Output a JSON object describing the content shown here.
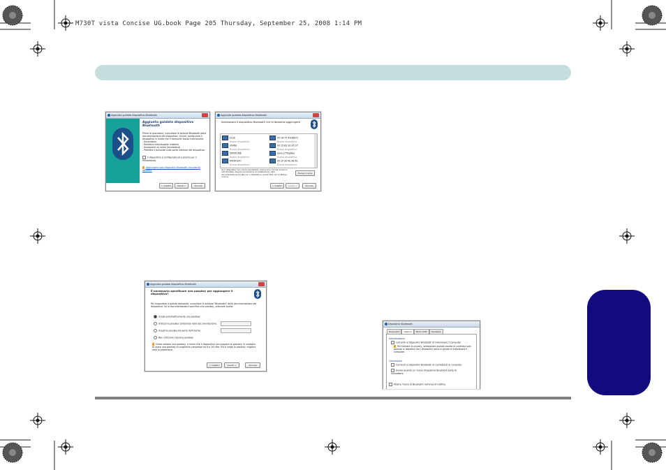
{
  "print_header": "M730T vista Concise UG.book  Page 205  Thursday, September 25, 2008  1:14 PM",
  "screenshots": {
    "wizard_intro": {
      "window_title": "Aggiunta guidata dispositivo Bluetooth",
      "heading": "Aggiunta guidata dispositivo",
      "heading2": "Bluetooth",
      "body": "Prima di procedere, consultare la sezione Bluetooth della documentazione del dispositivo. Quindi, configurare il dispositivo in modo che il computer possa individuarlo:",
      "bullets": [
        "- Accenderlo",
        "- Renderlo individuabile (visibile)",
        "- Assegnare un nome (facoltativo)",
        "- Premere il pulsante sulla parte inferiore del dispositivo"
      ],
      "checkbox": "Il dispositivo è configurato ed è pronto per il rilevamento",
      "link": "Aggiungere solo dispositivi Bluetooth considerati affidabili",
      "buttons": [
        "< Indietro",
        "Avanti >",
        "Annulla"
      ]
    },
    "wizard_select": {
      "window_title": "Aggiunta guidata dispositivo Bluetooth",
      "heading": "Selezionare il dispositivo Bluetooth che si desidera aggiungere.",
      "devices": [
        {
          "name": "ELSE",
          "type": "Nuovo dispositivo"
        },
        {
          "name": "00:1A:75:4D:8B:F2",
          "type": "Nuovo dispositivo"
        },
        {
          "name": "JOHNS",
          "type": "Nuovo dispositivo"
        },
        {
          "name": "00:15:83:3E:A5:37",
          "type": "Nuovo dispositivo"
        },
        {
          "name": "DRIVELINE",
          "type": "Nuovo dispositivo"
        },
        {
          "name": "pavo.27flap8ba",
          "type": "Nuovo dispositivo"
        },
        {
          "name": "MICROLVO",
          "type": "Nuovo dispositivo"
        },
        {
          "name": "00:1F:3A:4E:2B:6C",
          "type": "Nuovo dispositivo"
        }
      ],
      "note": "Se il dispositivo non viene visualizzato, assicurarsi che sia acceso e individuabile. Seguire le istruzioni di installazione nella documentazione fornita con il dispositivo, quindi fare clic su Nuova ricerca.",
      "rescan_button": "Nuova ricerca",
      "buttons": [
        "< Indietro",
        "Avanti >",
        "Annulla"
      ]
    },
    "wizard_passkey": {
      "window_title": "Aggiunta guidata dispositivo Bluetooth",
      "heading": "È necessario specificare una passkey per aggiungere il dispositivo?",
      "body": "Per rispondere a questa domanda, consultare la sezione \"Bluetooth\" della documentazione del dispositivo. Se la documentazione specifica una passkey, utilizzare quella.",
      "options": [
        "Scegli automaticamente una passkey",
        "Utilizza la passkey contenuta nella documentazione:",
        "Scegli la passkey da parte dell'utente:",
        "Non utilizzare nessuna passkey"
      ],
      "warning": "Usare sempre una passkey, a meno che il dispositivo non supporti la passkey. Si consiglia di usare una passkey di lunghezza compresa tra 8 e 16 cifre. Più è lunga la passkey, migliore sarà la protezione.",
      "buttons": [
        "< Indietro",
        "Avanti >",
        "Annulla"
      ]
    },
    "bt_devices_options": {
      "window_title": "Dispositivi Bluetooth",
      "tabs": [
        "Dispositivi",
        "Opzioni",
        "Porte COM",
        "Hardware"
      ],
      "group1_title": "Individuazione",
      "group1_check": "Consenti ai dispositivi Bluetooth di individuare il computer",
      "group1_warning": "Per tutelare la privacy, selezionare questa casella di controllo solo quando si desidera che i dispositivi siano in grado di individuare il computer.",
      "group2_title": "Connessioni",
      "group2_check1": "Consenti ai dispositivi Bluetooth di connettersi al computer",
      "group2_check2": "Avvisa quando un nuovo dispositivo Bluetooth tenta di connettersi",
      "bottom_check": "Mostra l'icona di Bluetooth nell'area di notifica"
    }
  },
  "colors": {
    "top_bar": "#c5dedd",
    "side_tab": "#140a80",
    "wizard_panel": "#16a29b"
  }
}
